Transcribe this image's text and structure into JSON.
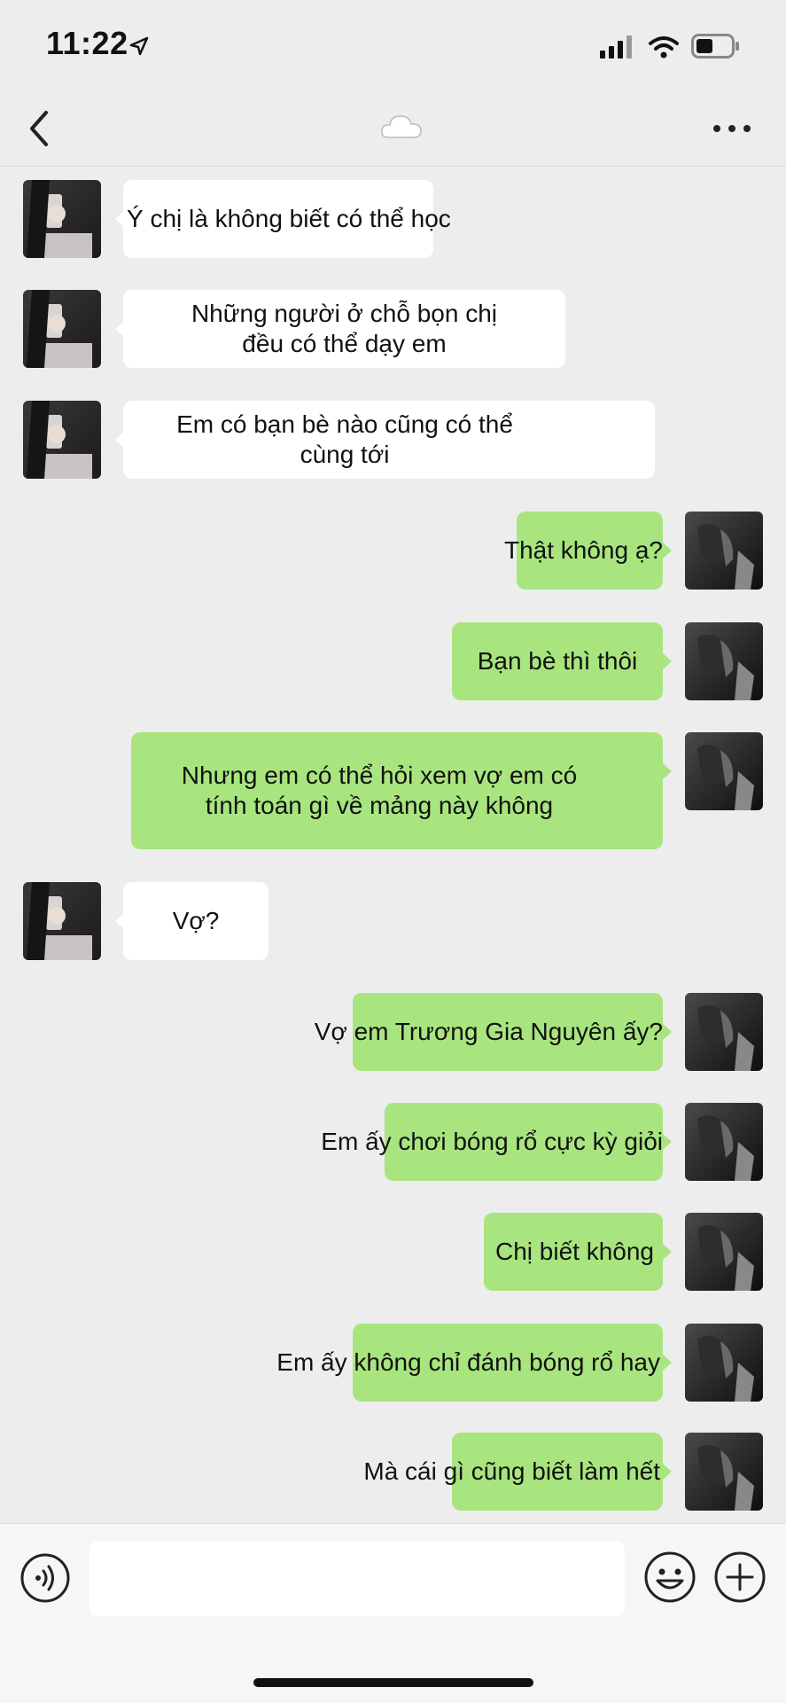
{
  "status_bar": {
    "time": "11:22",
    "icons": [
      "location-arrow-icon",
      "signal-icon",
      "wifi-icon",
      "battery-icon"
    ]
  },
  "header": {
    "back_icon": "chevron-left-icon",
    "title_icon": "cloud-icon",
    "more_icon": "more-dots-icon"
  },
  "colors": {
    "background": "#ededed",
    "incoming_bubble": "#ffffff",
    "outgoing_bubble": "#a8e57f"
  },
  "messages": [
    {
      "side": "left",
      "text": "Ý chị là không biết có thể học"
    },
    {
      "side": "left",
      "text": "Những người ở chỗ bọn chị\nđều có thể dạy em"
    },
    {
      "side": "left",
      "text": "Em có bạn bè nào cũng có thể\ncùng tới"
    },
    {
      "side": "right",
      "text": "Thật không ạ?"
    },
    {
      "side": "right",
      "text": "Bạn bè thì thôi"
    },
    {
      "side": "right",
      "text": "Nhưng em có thể hỏi xem vợ em có\ntính toán gì về mảng này không"
    },
    {
      "side": "left",
      "text": "Vợ?"
    },
    {
      "side": "right",
      "text": "Vợ em Trương Gia Nguyên ấy?"
    },
    {
      "side": "right",
      "text": "Em ấy chơi bóng rổ cực kỳ giỏi"
    },
    {
      "side": "right",
      "text": "Chị biết không"
    },
    {
      "side": "right",
      "text": "Em ấy không chỉ đánh bóng rổ hay"
    },
    {
      "side": "right",
      "text": "Mà cái gì cũng biết làm hết"
    }
  ],
  "input_bar": {
    "voice_icon": "voice-icon",
    "emoji_icon": "emoji-icon",
    "plus_icon": "plus-icon"
  }
}
